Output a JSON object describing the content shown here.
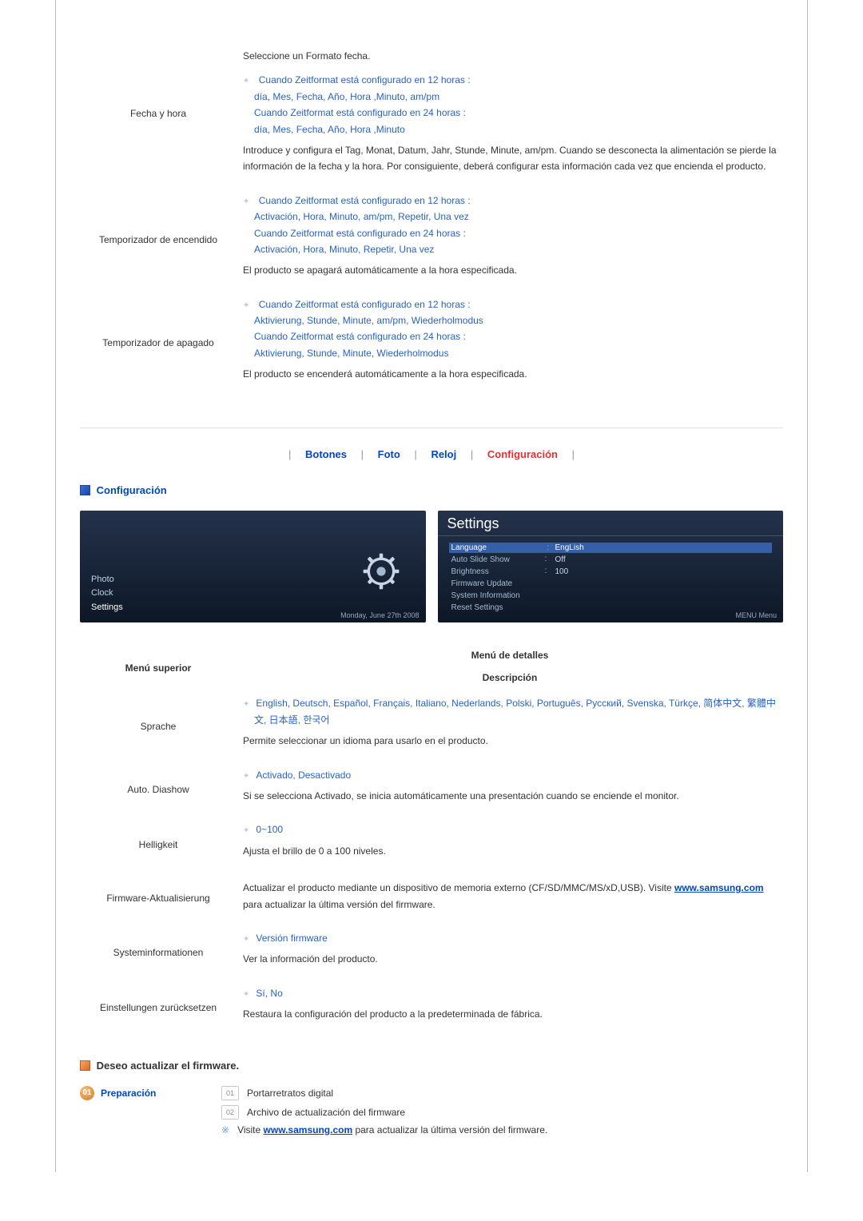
{
  "top_table": [
    {
      "label": "Fecha y hora",
      "opts": [
        "Cuando Zeitformat está configurado en 12 horas :",
        "día, Mes, Fecha, Año, Hora ,Minuto, am/pm",
        "Cuando Zeitformat está configurado en 24 horas :",
        "día, Mes, Fecha, Año, Hora ,Minuto"
      ],
      "pre_desc": "Seleccione un Formato fecha.",
      "desc": "Introduce y configura el Tag, Monat, Datum, Jahr, Stunde, Minute, am/pm. Cuando se desconecta la alimentación se pierde la información de la fecha y la hora. Por consiguiente, deberá configurar esta información cada vez que encienda el producto."
    },
    {
      "label": "Temporizador de encendido",
      "opts": [
        "Cuando Zeitformat está configurado en 12 horas :",
        "Activación, Hora, Minuto, am/pm, Repetir, Una vez",
        "Cuando Zeitformat está configurado en 24 horas :",
        "Activación, Hora, Minuto, Repetir, Una vez"
      ],
      "desc": "El producto se apagará automáticamente a la hora especificada."
    },
    {
      "label": "Temporizador de apagado",
      "opts": [
        "Cuando Zeitformat está configurado en 12 horas :",
        "Aktivierung, Stunde, Minute, am/pm, Wiederholmodus",
        "Cuando Zeitformat está configurado en 24 horas :",
        "Aktivierung, Stunde, Minute, Wiederholmodus"
      ],
      "desc": "El producto se encenderá automáticamente a la hora especificada."
    }
  ],
  "tabs": {
    "t1": "Botones",
    "t2": "Foto",
    "t3": "Reloj",
    "t4": "Configuración"
  },
  "section_label": "Configuración",
  "screen_left": {
    "menu": [
      "Photo",
      "Clock",
      "Settings"
    ],
    "footer": "Monday, June 27th 2008"
  },
  "screen_right": {
    "title": "Settings",
    "rows": [
      {
        "label": "Language",
        "value": "EngLish",
        "highlight": true
      },
      {
        "label": "Auto Slide Show",
        "value": "Off"
      },
      {
        "label": "Brightness",
        "value": "100"
      },
      {
        "label": "Firmware Update",
        "value": ""
      },
      {
        "label": "System Information",
        "value": ""
      },
      {
        "label": "Reset Settings",
        "value": ""
      }
    ],
    "footer": "MENU Menu"
  },
  "details_hdr": {
    "left": "Menú superior",
    "right_top": "Menú de detalles",
    "right_bot": "Descripción"
  },
  "details": [
    {
      "label": "Sprache",
      "opt": "English, Deutsch, Español, Français, Italiano, Nederlands, Polski, Português, Русский, Svenska, Türkçe, 简体中文, 繁體中文, 日本語, 한국어",
      "desc": "Permite seleccionar un idioma para usarlo en el producto."
    },
    {
      "label": "Auto. Diashow",
      "opt": "Activado, Desactivado",
      "desc": "Si se selecciona Activado, se inicia automáticamente una presentación cuando se enciende el monitor."
    },
    {
      "label": "Helligkeit",
      "opt": "0~100",
      "desc": "Ajusta el brillo de 0 a 100 niveles."
    },
    {
      "label": "Firmware-Aktualisierung",
      "opt": "",
      "desc_pre": "Actualizar el producto mediante un dispositivo de memoria externo (CF/SD/MMC/MS/xD,USB). Visite ",
      "link": "www.samsung.com",
      "desc_post": " para actualizar la última versión del firmware."
    },
    {
      "label": "Systeminformationen",
      "opt": "Versión firmware",
      "desc": "Ver la información del producto."
    },
    {
      "label": "Einstellungen zurücksetzen",
      "opt": "Sí, No",
      "desc": "Restaura la configuración del producto a la predeterminada de fábrica."
    }
  ],
  "firmware_section": "Deseo actualizar el firmware.",
  "prep": {
    "title": "Preparación",
    "num1": "01",
    "num2": "02",
    "item1": "Portarretratos digital",
    "item2": "Archivo de actualización del firmware",
    "note_pre": "Visite ",
    "note_link": "www.samsung.com",
    "note_post": " para actualizar la última versión del firmware."
  }
}
